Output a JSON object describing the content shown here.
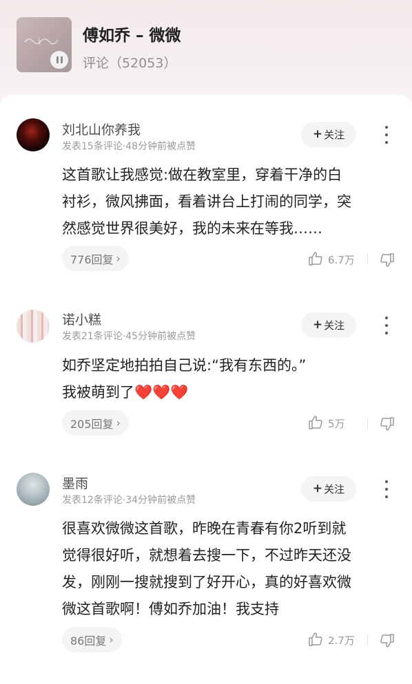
{
  "header": {
    "song_title": "傅如乔 – 微微",
    "comment_count_label": "评论（52053）"
  },
  "comments": [
    {
      "username": "刘北山你养我",
      "meta": "发表15条评论·48分钟前被点赞",
      "follow_label": "关注",
      "lines": [
        "这首歌让我感觉:做在教室里，穿着干净的白",
        "衬衫，微风拂面，看着讲台上打闹的同学，突",
        "然感觉世界很美好，我的未来在等我……"
      ],
      "replies_label": "776回复",
      "likes": "6.7万"
    },
    {
      "username": "诺小糕",
      "meta": "发表21条评论·45分钟前被点赞",
      "follow_label": "关注",
      "lines": [
        "如乔坚定地拍拍自己说:“我有东西的。”",
        " 我被萌到了"
      ],
      "emoji": "❤️❤️❤️",
      "replies_label": "205回复",
      "likes": "5万"
    },
    {
      "username": "墨雨",
      "meta": "发表12条评论·34分钟前被点赞",
      "follow_label": "关注",
      "lines": [
        "很喜欢微微这首歌，昨晚在青春有你2听到就",
        "觉得很好听，就想着去搜一下，不过昨天还没",
        "发，刚刚一搜就搜到了好开心，真的好喜欢微",
        "微这首歌啊！傅如乔加油！我支持"
      ],
      "replies_label": "86回复",
      "likes": "2.7万"
    }
  ]
}
